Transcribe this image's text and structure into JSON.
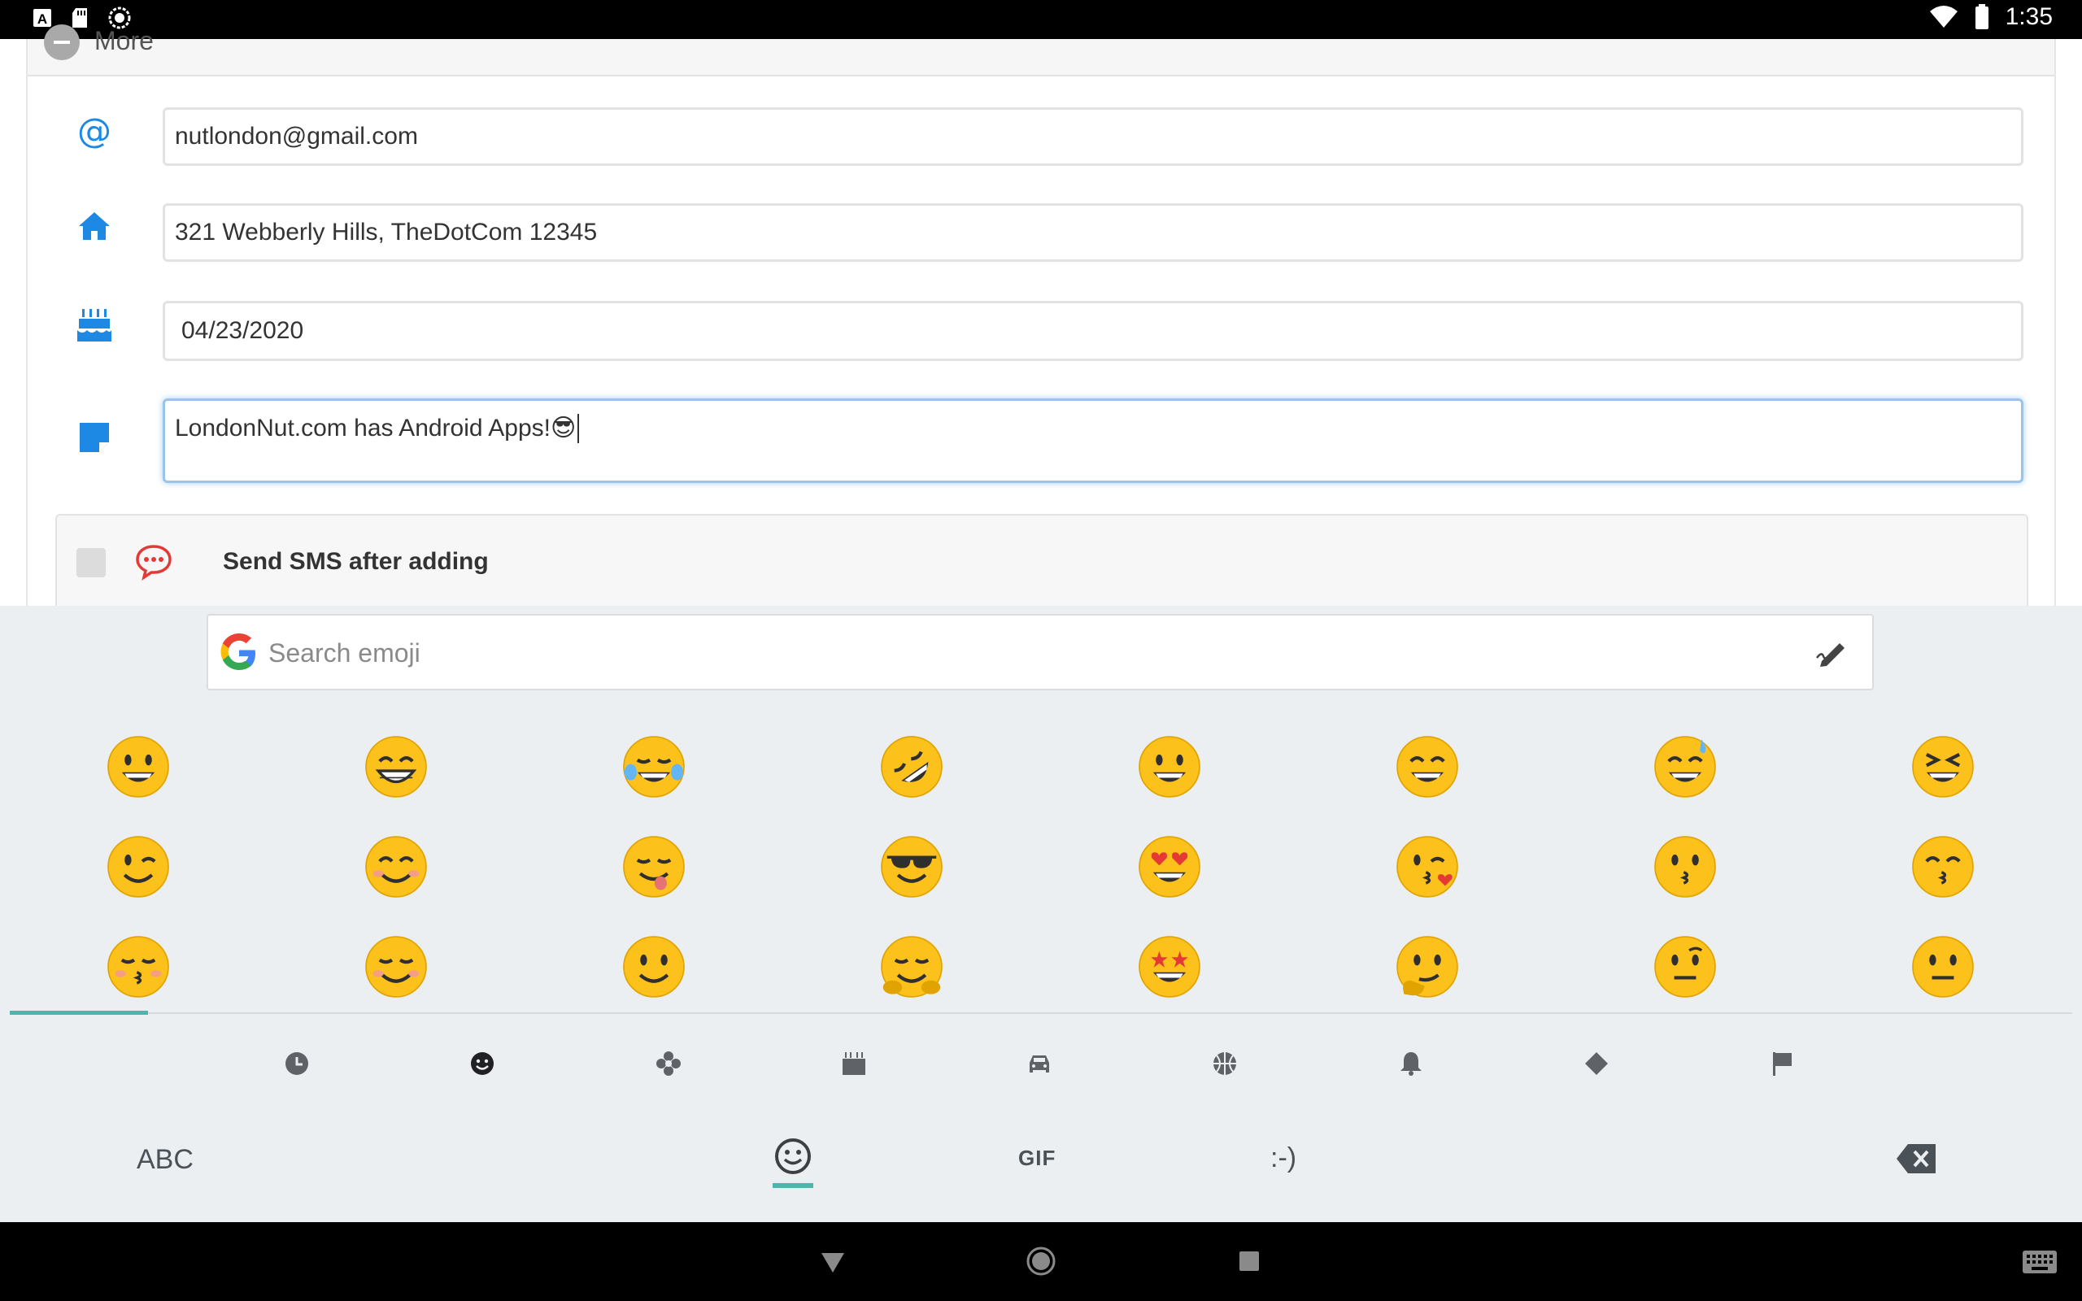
{
  "status_bar": {
    "time": "1:35",
    "left_icons": [
      "font-a-icon",
      "sd-card-icon",
      "sync-circle-icon"
    ],
    "right_icons": [
      "wifi-icon",
      "battery-icon"
    ]
  },
  "form": {
    "more_label": "More",
    "email": {
      "icon": "at-icon",
      "value": "nutlondon@gmail.com"
    },
    "address": {
      "icon": "home-icon",
      "value": "321 Webberly Hills, TheDotCom 12345"
    },
    "birthday": {
      "icon": "birthday-cake-icon",
      "value": "04/23/2020"
    },
    "note": {
      "icon": "sticky-note-icon",
      "value": "LondonNut.com has Android Apps!😎"
    },
    "sms": {
      "icon": "chat-bubble-icon",
      "label": "Send SMS after adding",
      "checked": false
    }
  },
  "keyboard": {
    "search": {
      "placeholder": "Search emoji",
      "icon": "google-g-icon",
      "handwriting_icon": "pen-icon"
    },
    "emoji_rows": [
      [
        "grinning",
        "beaming",
        "tears-of-joy",
        "rolling-on-floor-laughing",
        "grinning-big-eyes",
        "grinning-smiling-eyes",
        "grinning-sweat",
        "squinting-laughing"
      ],
      [
        "winking",
        "smiling-eyes",
        "savoring-food",
        "sunglasses",
        "heart-eyes",
        "blowing-kiss",
        "kissing",
        "kissing-smiling-eyes"
      ],
      [
        "kissing-closed-eyes",
        "smiling-blush",
        "slightly-smiling",
        "hugging",
        "star-struck",
        "thinking",
        "raised-eyebrow",
        "neutral"
      ]
    ],
    "categories": [
      "clock-icon",
      "smiley-icon",
      "flower-icon",
      "cake-icon",
      "car-icon",
      "basketball-icon",
      "bell-icon",
      "diamond-icon",
      "flag-icon"
    ],
    "active_category": 1,
    "bottom": {
      "abc_label": "ABC",
      "gif_label": "GIF",
      "emoticon_label": ":-)",
      "emoji_key_icon": "smiley-icon",
      "backspace_icon": "backspace-icon"
    }
  },
  "nav_bar": {
    "buttons": [
      "back-icon",
      "home-icon",
      "recents-icon"
    ],
    "extra": "keyboard-switch-icon"
  },
  "colors": {
    "accent_blue": "#1e88e5",
    "teal_indicator": "#4db6ac",
    "keyboard_bg": "#eceff1",
    "sms_red": "#e53935"
  }
}
